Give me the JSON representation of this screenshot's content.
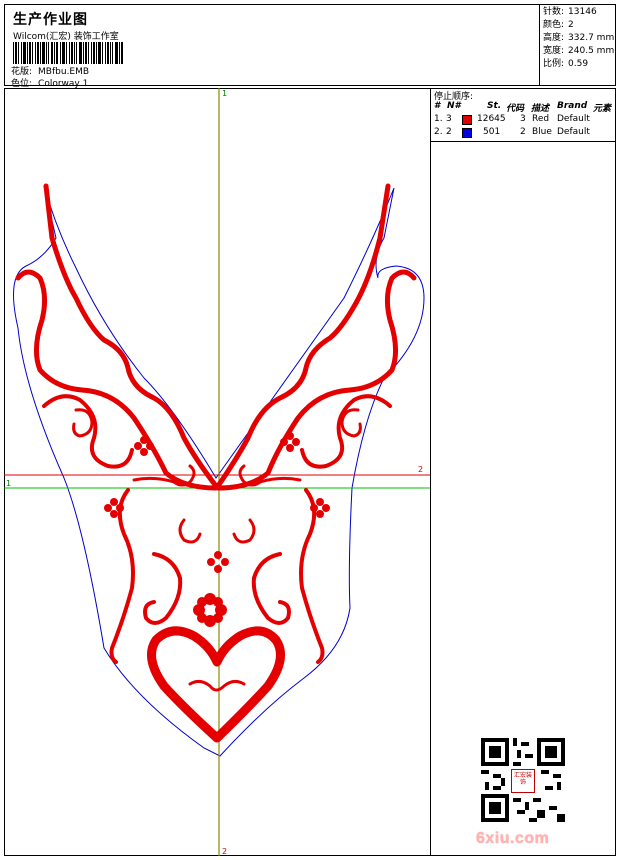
{
  "header": {
    "title": "生产作业图",
    "subtitle": "Wilcom(汇宏) 装饰工作室",
    "design_label": "花版:",
    "design_value": "MBfbu.EMB",
    "colorway_label": "色位:",
    "colorway_value": "Colorway 1"
  },
  "stats": [
    {
      "label": "针数:",
      "value": "13146"
    },
    {
      "label": "颜色:",
      "value": "2"
    },
    {
      "label": "高度:",
      "value": "332.7 mm"
    },
    {
      "label": "宽度:",
      "value": "240.5 mm"
    },
    {
      "label": "比例:",
      "value": "0.59"
    }
  ],
  "threads": {
    "title": "停止顺序:",
    "headers": [
      "#",
      "N#",
      "St.",
      "代码",
      "描述",
      "Brand",
      "元素"
    ],
    "rows": [
      {
        "idx": "1.",
        "num": "3",
        "color": "#e00000",
        "stitches": "12645",
        "code": "3",
        "desc": "Red",
        "brand": "Default"
      },
      {
        "idx": "2.",
        "num": "2",
        "color": "#0000e0",
        "stitches": "501",
        "code": "2",
        "desc": "Blue",
        "brand": "Default"
      }
    ]
  },
  "guides": {
    "v_top": "1",
    "v_bottom": "2",
    "h_green": "1",
    "h_red": "2"
  },
  "seal_text": "汇宏装饰",
  "watermark": "6xiu.com"
}
